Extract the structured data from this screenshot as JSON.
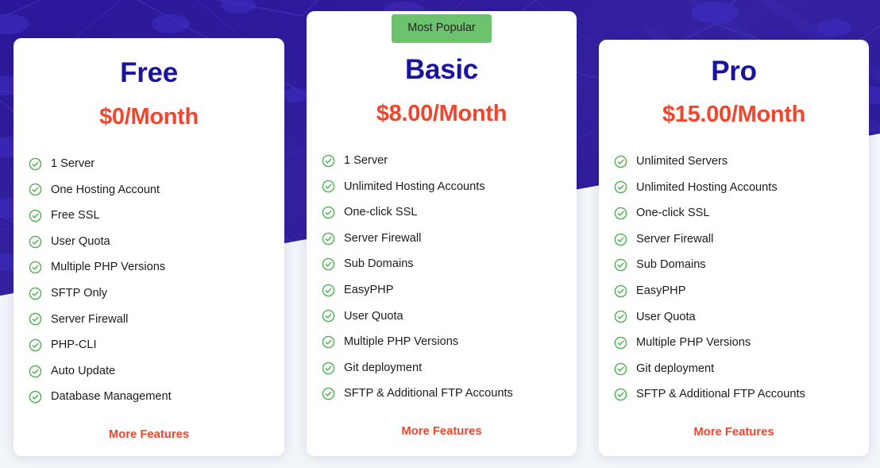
{
  "theme": {
    "hero_background": "#2f1ca8",
    "page_background": "#f2f6fa",
    "plan_name_color": "#1a13a0",
    "price_color": "#f4452c",
    "badge_color": "#6dc36d",
    "check_color": "#4caf50",
    "link_color": "#f4452c"
  },
  "plans": [
    {
      "name": "Free",
      "price": "$0/Month",
      "badge": null,
      "features": [
        "1 Server",
        "One Hosting Account",
        "Free SSL",
        "User Quota",
        "Multiple PHP Versions",
        "SFTP Only",
        "Server Firewall",
        "PHP-CLI",
        "Auto Update",
        "Database Management"
      ],
      "more_features_label": "More Features"
    },
    {
      "name": "Basic",
      "price": "$8.00/Month",
      "badge": "Most Popular",
      "features": [
        "1 Server",
        "Unlimited Hosting Accounts",
        "One-click SSL",
        "Server Firewall",
        "Sub Domains",
        "EasyPHP",
        "User Quota",
        "Multiple PHP Versions",
        "Git deployment",
        "SFTP & Additional FTP Accounts"
      ],
      "more_features_label": "More Features"
    },
    {
      "name": "Pro",
      "price": "$15.00/Month",
      "badge": null,
      "features": [
        "Unlimited Servers",
        "Unlimited Hosting Accounts",
        "One-click SSL",
        "Server Firewall",
        "Sub Domains",
        "EasyPHP",
        "User Quota",
        "Multiple PHP Versions",
        "Git deployment",
        "SFTP & Additional FTP Accounts"
      ],
      "more_features_label": "More Features"
    }
  ]
}
